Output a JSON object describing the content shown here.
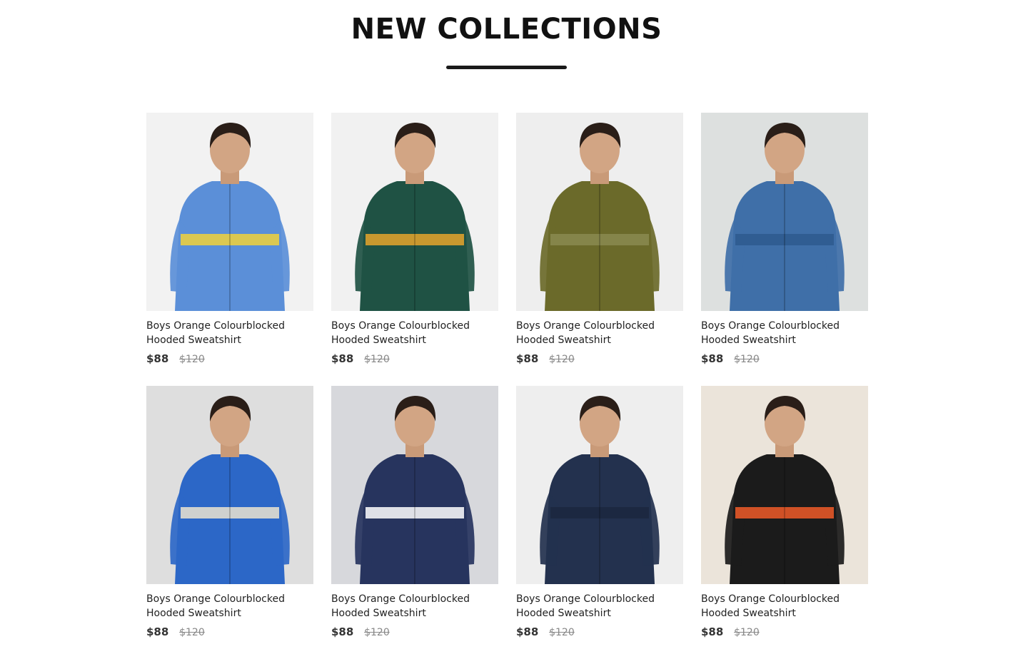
{
  "section": {
    "title": "NEW COLLECTIONS"
  },
  "products": [
    {
      "name_line1": "Boys Orange Colourblocked",
      "name_line2": "Hooded Sweatshirt",
      "price": "$88",
      "old_price": "$120",
      "bg": "#f2f2f2",
      "garment": "#5b8fd8",
      "accent": "#f2d23a"
    },
    {
      "name_line1": "Boys Orange Colourblocked",
      "name_line2": "Hooded Sweatshirt",
      "price": "$88",
      "old_price": "$120",
      "bg": "#f1f1f1",
      "garment": "#1f5244",
      "accent": "#e7a52b"
    },
    {
      "name_line1": "Boys Orange Colourblocked",
      "name_line2": "Hooded Sweatshirt",
      "price": "$88",
      "old_price": "$120",
      "bg": "#eeeeee",
      "garment": "#6b6a2a",
      "accent": "#8a8a50"
    },
    {
      "name_line1": "Boys Orange Colourblocked",
      "name_line2": "Hooded Sweatshirt",
      "price": "$88",
      "old_price": "$120",
      "bg": "#dde0df",
      "garment": "#3f6fa8",
      "accent": "#2e5a8e"
    },
    {
      "name_line1": "Boys Orange Colourblocked",
      "name_line2": "Hooded Sweatshirt",
      "price": "$88",
      "old_price": "$120",
      "bg": "#dedede",
      "garment": "#2c67c7",
      "accent": "#ece4d0"
    },
    {
      "name_line1": "Boys Orange Colourblocked",
      "name_line2": "Hooded Sweatshirt",
      "price": "$88",
      "old_price": "$120",
      "bg": "#d7d8dc",
      "garment": "#27345e",
      "accent": "#ffffff"
    },
    {
      "name_line1": "Boys Orange Colourblocked",
      "name_line2": "Hooded Sweatshirt",
      "price": "$88",
      "old_price": "$120",
      "bg": "#eeeeee",
      "garment": "#23314e",
      "accent": "#1b2740"
    },
    {
      "name_line1": "Boys Orange Colourblocked",
      "name_line2": "Hooded Sweatshirt",
      "price": "$88",
      "old_price": "$120",
      "bg": "#ebe4da",
      "garment": "#1b1b1b",
      "accent": "#f05a28"
    }
  ]
}
